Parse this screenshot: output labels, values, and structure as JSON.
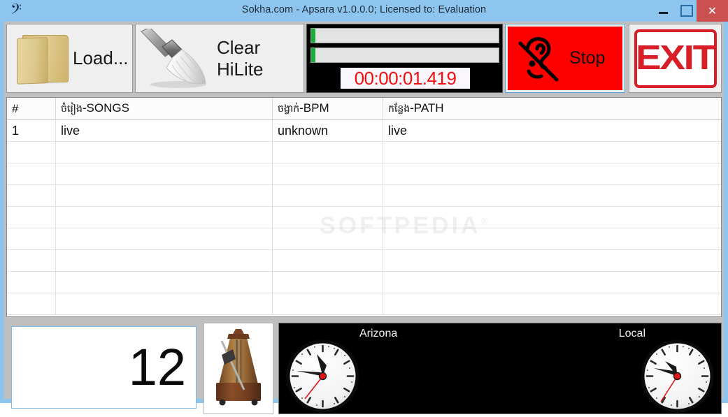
{
  "window": {
    "title": "Sokha.com - Apsara v1.0.0.0; Licensed to: Evaluation",
    "app_icon": "bass-clef-icon",
    "titlebar_color": "#8ec5ef",
    "close_button_color": "#cb5050",
    "minimize_label": "–",
    "maximize_label": "☐",
    "close_label": "✕"
  },
  "toolbar": {
    "load_label": "Load...",
    "load_icon": "folder-icon",
    "clear_label": "Clear HiLite",
    "clear_icon": "brush-icon",
    "stop_label": "Stop",
    "stop_icon": "deaf-ear-icon",
    "stop_color": "#fd0000",
    "exit_label": "EXIT",
    "exit_color": "#d81f27"
  },
  "timer": {
    "readout": "00:00:01.419",
    "readout_color": "#f40d0d",
    "background": "#000000",
    "progress_bars": [
      {
        "name": "progress-bar-1",
        "percent": 2,
        "fill_color": "#16b23c"
      },
      {
        "name": "progress-bar-2",
        "percent": 2,
        "fill_color": "#16b23c"
      }
    ]
  },
  "grid": {
    "columns": [
      {
        "key": "num",
        "label": "#"
      },
      {
        "key": "song",
        "label_khmer": "ចំរៀង",
        "label": "-SONGS"
      },
      {
        "key": "bpm",
        "label_khmer": "ចង្វាក់",
        "label": "-BPM"
      },
      {
        "key": "path",
        "label_khmer": "កន្លែង",
        "label": "-PATH"
      }
    ],
    "rows": [
      {
        "num": "1",
        "song": "live",
        "bpm": "unknown",
        "path": "live"
      }
    ],
    "empty_row_count": 8,
    "watermark": "SOFTPEDIA"
  },
  "bottom": {
    "bpm_value": "12",
    "metronome_icon": "metronome-icon",
    "clocks": [
      {
        "name": "clock-arizona",
        "label": "Arizona",
        "hour_angle": 278,
        "minute_angle": 35,
        "second_angle": 218
      },
      {
        "name": "clock-local",
        "label": "Local",
        "hour_angle": 288,
        "minute_angle": 310,
        "second_angle": 208
      }
    ]
  }
}
